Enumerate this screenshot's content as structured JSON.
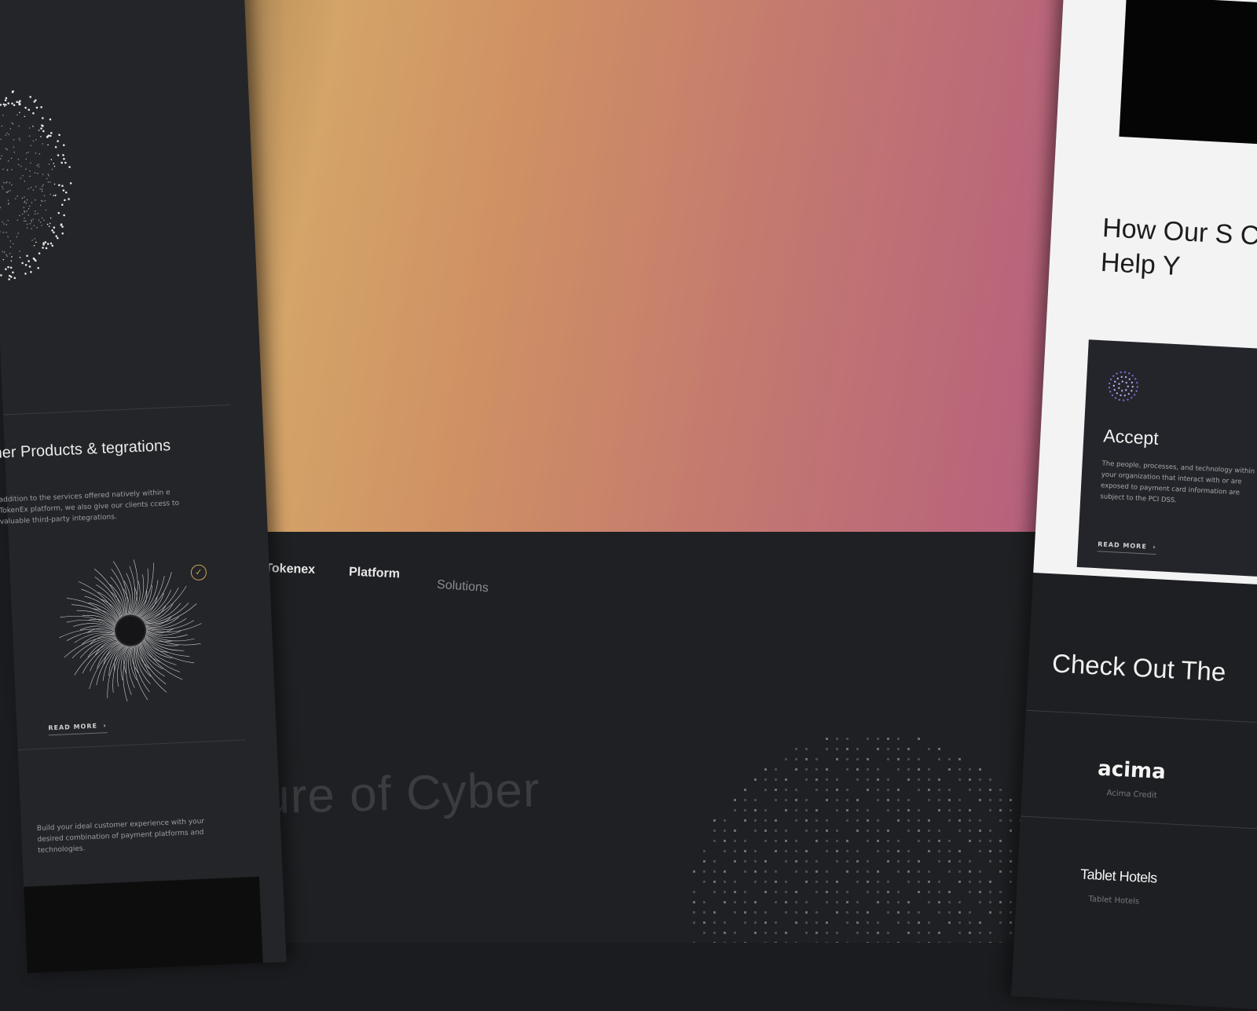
{
  "nav": {
    "items": [
      "What is Tokenex",
      "Platform",
      "Solutions"
    ]
  },
  "hero": {
    "headline": "ture of Cyber"
  },
  "left_panel": {
    "title": "ther Products & tegrations",
    "description": "addition to the services offered natively within e TokenEx platform, we also give our clients ccess to valuable third-party integrations.",
    "read_more": "READ MORE",
    "description2": "Build your ideal customer experience with your desired combination of payment platforms and technologies."
  },
  "right_panel": {
    "heading": "How Our S Can Help Y",
    "card": {
      "title": "Accept",
      "description": "The people, processes, and technology within your organization that interact with or are exposed to payment card information are subject to the PCI DSS.",
      "read_more": "READ MORE"
    },
    "check_out_title": "Check Out The",
    "logos": [
      {
        "name": "acima",
        "caption": "Acima Credit"
      },
      {
        "name": "Tablet Hotels",
        "caption": "Tablet Hotels"
      }
    ]
  },
  "colors": {
    "gradient_start": "#d4a468",
    "gradient_end": "#b45c80",
    "accent_gold": "#c9a45c",
    "accent_purple": "#7b68d8"
  },
  "icons": [
    "chevron-right-icon",
    "check-circle-icon",
    "dot-sphere-icon",
    "dot-globe-icon",
    "line-burst-icon"
  ]
}
